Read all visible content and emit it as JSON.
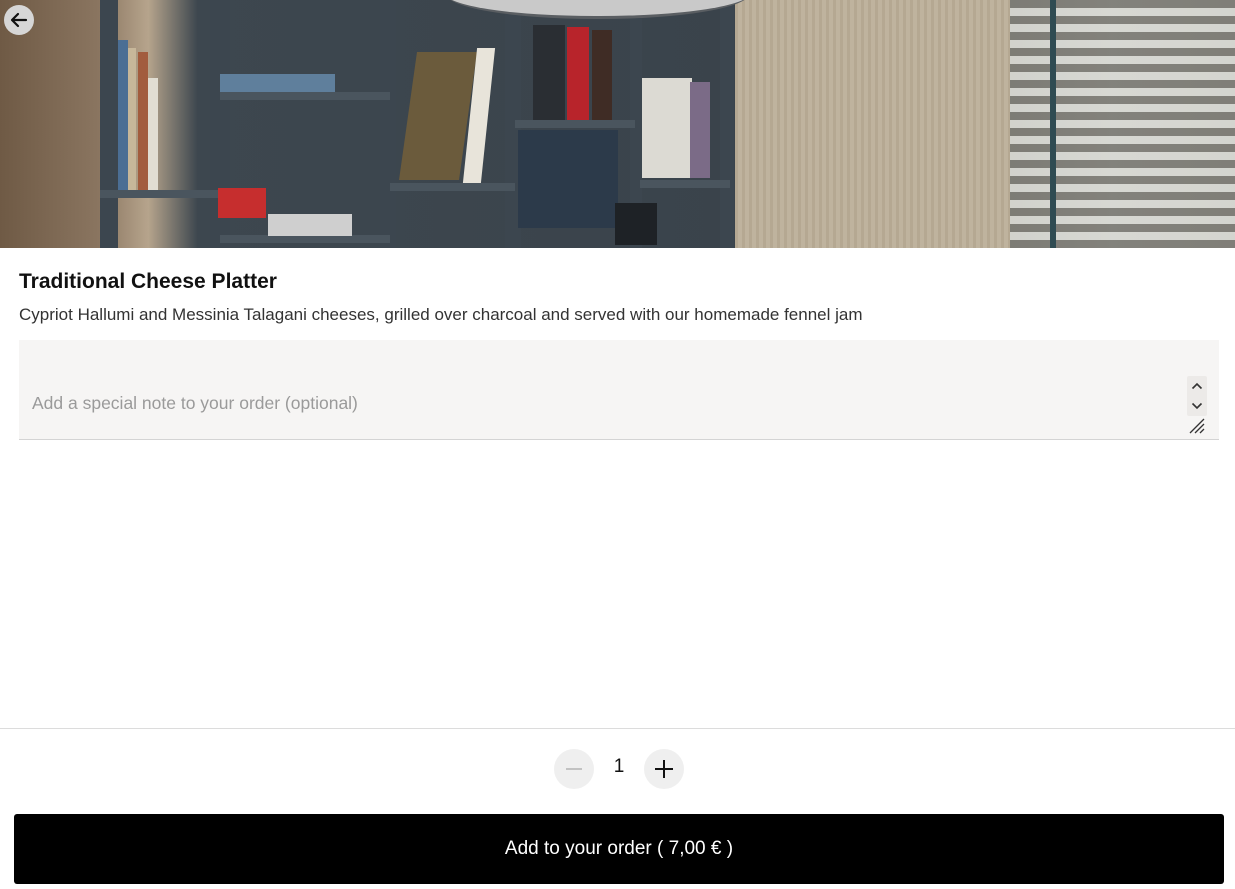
{
  "product": {
    "title": "Traditional Cheese Platter",
    "description": "Cypriot Hallumi and Messinia Talagani cheeses, grilled over charcoal and served with our homemade fennel jam"
  },
  "note": {
    "placeholder": "Add a special note to your order (optional)",
    "value": ""
  },
  "quantity": {
    "value": "1"
  },
  "cta": {
    "label": "Add to your order",
    "price": "( 7,00 € )"
  },
  "icons": {
    "back": "arrow-left-icon",
    "minus": "minus-icon",
    "plus": "plus-icon",
    "spin_up": "chevron-up-icon",
    "spin_down": "chevron-down-icon",
    "resize": "resize-handle-icon"
  },
  "colors": {
    "cta_background": "#000000",
    "cta_text": "#ffffff",
    "note_background": "#f6f5f4",
    "qty_button_background": "#efefef"
  }
}
